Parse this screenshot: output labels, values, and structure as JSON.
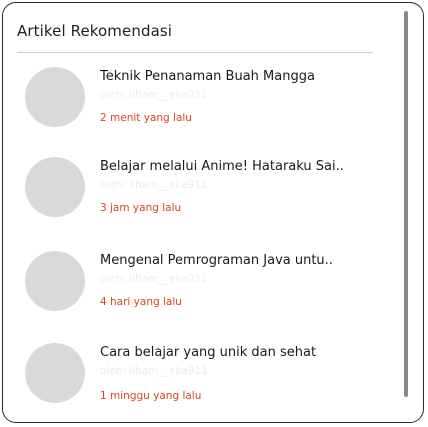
{
  "panel": {
    "title": "Artikel Rekomendasi"
  },
  "articles": [
    {
      "title": "Teknik Penanaman Buah Mangga",
      "author": "oleh: ilham__eka911",
      "time": "2 menit yang lalu"
    },
    {
      "title": "Belajar melalui Anime! Hataraku Sai..",
      "author": "oleh: ilham__eka911",
      "time": "3 jam yang lalu"
    },
    {
      "title": "Mengenal Pemrograman Java untu..",
      "author": "oleh: ilham__eka911",
      "time": "4 hari yang lalu"
    },
    {
      "title": "Cara belajar yang unik dan sehat",
      "author": "oleh: ilham__eka911",
      "time": "1 minggu yang lalu"
    }
  ],
  "colors": {
    "time_accent": "#d4481b",
    "avatar_placeholder": "#d9d9d9",
    "border": "#2b2b2b"
  }
}
